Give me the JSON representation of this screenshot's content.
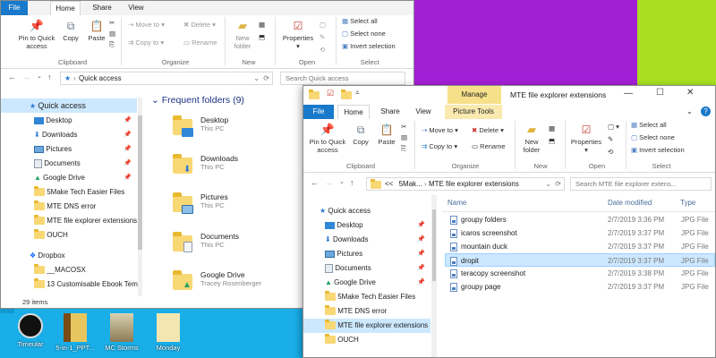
{
  "colors": {
    "wallpaper_blue": "#19aee8",
    "wallpaper_purple": "#a31fd6",
    "wallpaper_lime": "#a8e021",
    "file_tab": "#1979ca",
    "selection": "#cce8ff",
    "manage_tab": "#f7e08a",
    "picture_tools": "#f1d56a"
  },
  "window_back": {
    "tabs": [
      "File",
      "Home",
      "Share",
      "View"
    ],
    "ribbon": {
      "pin_label": "Pin to Quick access",
      "copy_label": "Copy",
      "paste_label": "Paste",
      "move_to": "Move to",
      "copy_to": "Copy to",
      "delete": "Delete",
      "rename": "Rename",
      "new_folder": "New folder",
      "properties": "Properties",
      "select_all": "Select all",
      "select_none": "Select none",
      "invert_selection": "Invert selection",
      "groups": [
        "Clipboard",
        "Organize",
        "New",
        "Open",
        "Select"
      ]
    },
    "address": "Quick access",
    "search_placeholder": "Search Quick access",
    "nav": [
      {
        "label": "Quick access",
        "icon": "star-icon",
        "pinned": false,
        "selected": true
      },
      {
        "label": "Desktop",
        "icon": "desktop-icon",
        "pinned": true
      },
      {
        "label": "Downloads",
        "icon": "download-icon",
        "pinned": true
      },
      {
        "label": "Pictures",
        "icon": "pictures-icon",
        "pinned": true
      },
      {
        "label": "Documents",
        "icon": "documents-icon",
        "pinned": true
      },
      {
        "label": "Google Drive",
        "icon": "google-drive-icon",
        "pinned": true
      },
      {
        "label": "5Make Tech Easier Files",
        "icon": "folder-icon",
        "pinned": false
      },
      {
        "label": "MTE DNS error",
        "icon": "folder-icon",
        "pinned": false
      },
      {
        "label": "MTE file explorer extensions",
        "icon": "folder-icon",
        "pinned": false
      },
      {
        "label": "OUCH",
        "icon": "folder-icon",
        "pinned": false
      },
      {
        "label": "Dropbox",
        "icon": "dropbox-icon",
        "pinned": false
      },
      {
        "label": "__MACOSX",
        "icon": "folder-icon",
        "pinned": false
      },
      {
        "label": "13 Customisable Ebook Tem",
        "icon": "folder-icon",
        "pinned": false
      }
    ],
    "section_title": "Frequent folders (9)",
    "frequent": [
      {
        "name": "Desktop",
        "sub": "This PC"
      },
      {
        "name": "Downloads",
        "sub": "This PC"
      },
      {
        "name": "Pictures",
        "sub": "This PC"
      },
      {
        "name": "Documents",
        "sub": "This PC"
      },
      {
        "name": "Google Drive",
        "sub": "Tracey Rosenberger"
      }
    ],
    "status": "29 items"
  },
  "window_front": {
    "title": "MTE file explorer extensions",
    "manage_label": "Manage",
    "picture_tools_label": "Picture Tools",
    "tabs": [
      "File",
      "Home",
      "Share",
      "View"
    ],
    "ribbon": {
      "pin_label": "Pin to Quick access",
      "copy_label": "Copy",
      "paste_label": "Paste",
      "move_to": "Move to",
      "copy_to": "Copy to",
      "delete": "Delete",
      "rename": "Rename",
      "new_folder": "New folder",
      "properties": "Properties",
      "select_all": "Select all",
      "select_none": "Select none",
      "invert_selection": "Invert selection",
      "groups": [
        "Clipboard",
        "Organize",
        "New",
        "Open",
        "Select"
      ]
    },
    "breadcrumb": [
      "<<",
      "5Mak...",
      "MTE file explorer extensions"
    ],
    "search_placeholder": "Search MTE file explorer extens...",
    "nav": [
      {
        "label": "Quick access",
        "icon": "star-icon",
        "pinned": false
      },
      {
        "label": "Desktop",
        "icon": "desktop-icon",
        "pinned": true
      },
      {
        "label": "Downloads",
        "icon": "download-icon",
        "pinned": true
      },
      {
        "label": "Pictures",
        "icon": "pictures-icon",
        "pinned": true
      },
      {
        "label": "Documents",
        "icon": "documents-icon",
        "pinned": true
      },
      {
        "label": "Google Drive",
        "icon": "google-drive-icon",
        "pinned": true
      },
      {
        "label": "5Make Tech Easier Files",
        "icon": "folder-icon",
        "pinned": false
      },
      {
        "label": "MTE DNS error",
        "icon": "folder-icon",
        "pinned": false
      },
      {
        "label": "MTE file explorer extensions",
        "icon": "folder-icon",
        "pinned": false,
        "selected": true
      },
      {
        "label": "OUCH",
        "icon": "folder-icon",
        "pinned": false
      }
    ],
    "columns": [
      "Name",
      "Date modified",
      "Type"
    ],
    "files": [
      {
        "name": "groupy folders",
        "date": "2/7/2019 3:36 PM",
        "type": "JPG File"
      },
      {
        "name": "icaros screenshot",
        "date": "2/7/2019 3:37 PM",
        "type": "JPG File"
      },
      {
        "name": "mountain duck",
        "date": "2/7/2019 3:37 PM",
        "type": "JPG File"
      },
      {
        "name": "dropit",
        "date": "2/7/2019 3:37 PM",
        "type": "JPG File",
        "selected": true
      },
      {
        "name": "teracopy screenshot",
        "date": "2/7/2019 3:38 PM",
        "type": "JPG File"
      },
      {
        "name": "groupy page",
        "date": "2/7/2019 3:37 PM",
        "type": "JPG File"
      }
    ]
  },
  "desktop_icons": [
    {
      "label": "Timeular",
      "icon": "timeular-icon"
    },
    {
      "label": "5-in-1_PPT...",
      "icon": "file-icon"
    },
    {
      "label": "MC Storms",
      "icon": "file-icon"
    },
    {
      "label": "Monday",
      "icon": "file-icon"
    }
  ]
}
